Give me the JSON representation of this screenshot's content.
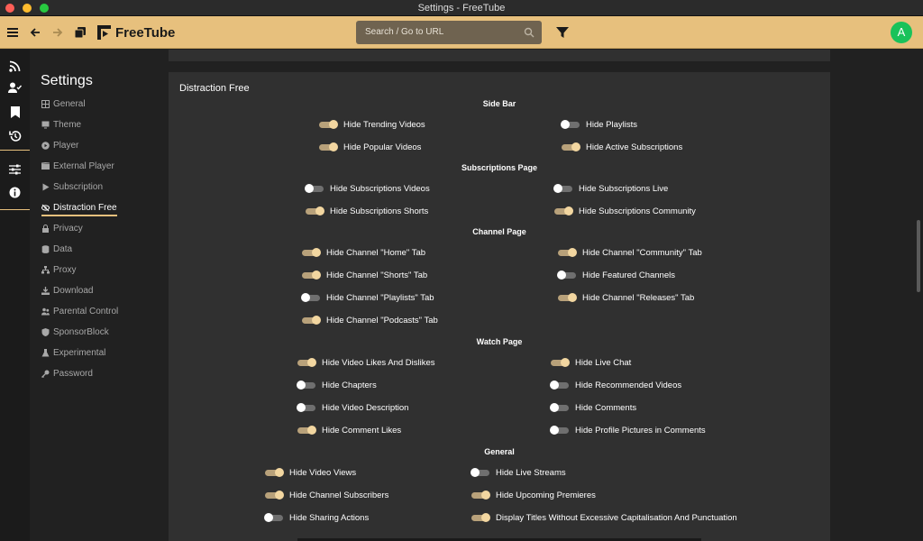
{
  "window": {
    "title": "Settings - FreeTube"
  },
  "topnav": {
    "logo_text": "FreeTube",
    "search_placeholder": "Search / Go to URL",
    "avatar_letter": "A"
  },
  "sidebar": {
    "title": "Settings",
    "items": [
      {
        "label": "General",
        "icon": "grid-icon"
      },
      {
        "label": "Theme",
        "icon": "monitor-icon"
      },
      {
        "label": "Player",
        "icon": "play-circle-icon"
      },
      {
        "label": "External Player",
        "icon": "film-icon"
      },
      {
        "label": "Subscription",
        "icon": "play-icon"
      },
      {
        "label": "Distraction Free",
        "icon": "eye-slash-icon",
        "active": true
      },
      {
        "label": "Privacy",
        "icon": "lock-icon"
      },
      {
        "label": "Data",
        "icon": "database-icon"
      },
      {
        "label": "Proxy",
        "icon": "network-icon"
      },
      {
        "label": "Download",
        "icon": "download-icon"
      },
      {
        "label": "Parental Control",
        "icon": "users-icon"
      },
      {
        "label": "SponsorBlock",
        "icon": "shield-icon"
      },
      {
        "label": "Experimental",
        "icon": "flask-icon"
      },
      {
        "label": "Password",
        "icon": "key-icon"
      }
    ]
  },
  "main": {
    "card_title": "Distraction Free",
    "sections": [
      {
        "title": "Side Bar",
        "options": [
          {
            "label": "Hide Trending Videos",
            "on": true
          },
          {
            "label": "Hide Playlists",
            "on": false
          },
          {
            "label": "Hide Popular Videos",
            "on": true
          },
          {
            "label": "Hide Active Subscriptions",
            "on": true
          }
        ]
      },
      {
        "title": "Subscriptions Page",
        "options": [
          {
            "label": "Hide Subscriptions Videos",
            "on": false
          },
          {
            "label": "Hide Subscriptions Live",
            "on": false
          },
          {
            "label": "Hide Subscriptions Shorts",
            "on": true
          },
          {
            "label": "Hide Subscriptions Community",
            "on": true
          }
        ]
      },
      {
        "title": "Channel Page",
        "options": [
          {
            "label": "Hide Channel \"Home\" Tab",
            "on": true
          },
          {
            "label": "Hide Channel \"Community\" Tab",
            "on": true
          },
          {
            "label": "Hide Channel \"Shorts\" Tab",
            "on": true
          },
          {
            "label": "Hide Featured Channels",
            "on": false
          },
          {
            "label": "Hide Channel \"Playlists\" Tab",
            "on": false
          },
          {
            "label": "Hide Channel \"Releases\" Tab",
            "on": true
          },
          {
            "label": "Hide Channel \"Podcasts\" Tab",
            "on": true
          }
        ]
      },
      {
        "title": "Watch Page",
        "options": [
          {
            "label": "Hide Video Likes And Dislikes",
            "on": true
          },
          {
            "label": "Hide Live Chat",
            "on": true
          },
          {
            "label": "Hide Chapters",
            "on": false
          },
          {
            "label": "Hide Recommended Videos",
            "on": false
          },
          {
            "label": "Hide Video Description",
            "on": false
          },
          {
            "label": "Hide Comments",
            "on": false
          },
          {
            "label": "Hide Comment Likes",
            "on": true
          },
          {
            "label": "Hide Profile Pictures in Comments",
            "on": false
          }
        ]
      },
      {
        "title": "General",
        "options": [
          {
            "label": "Hide Video Views",
            "on": true
          },
          {
            "label": "Hide Live Streams",
            "on": false
          },
          {
            "label": "Hide Channel Subscribers",
            "on": true
          },
          {
            "label": "Hide Upcoming Premieres",
            "on": true
          },
          {
            "label": "Hide Sharing Actions",
            "on": false
          },
          {
            "label": "Display Titles Without Excessive Capitalisation And Punctuation",
            "on": true
          }
        ]
      }
    ]
  },
  "colors": {
    "accent": "#e7c07d",
    "toggle_on": "#f2d6a0",
    "card": "#303030",
    "bg": "#212121"
  }
}
